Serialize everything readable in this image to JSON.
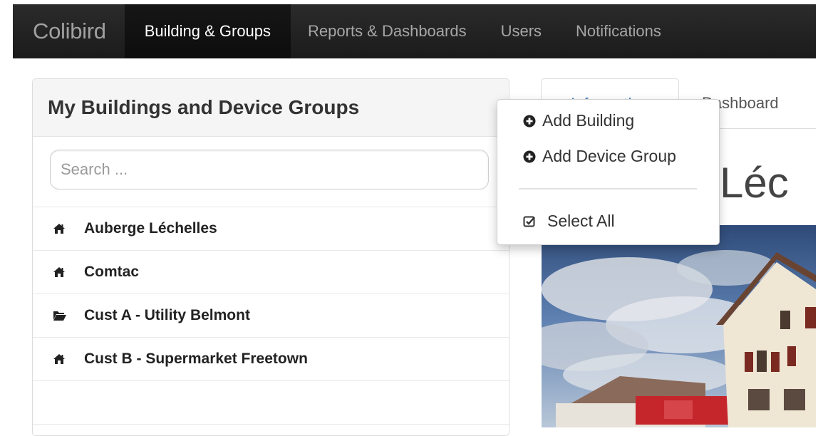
{
  "navbar": {
    "brand": "Colibird",
    "items": [
      {
        "label": "Building & Groups",
        "active": true
      },
      {
        "label": "Reports & Dashboards",
        "active": false
      },
      {
        "label": "Users",
        "active": false
      },
      {
        "label": "Notifications",
        "active": false
      }
    ]
  },
  "panel": {
    "title": "My Buildings and Device Groups",
    "search_placeholder": "Search ...",
    "items": [
      {
        "label": "Auberge Léchelles",
        "icon": "home-icon"
      },
      {
        "label": "Comtac",
        "icon": "home-icon"
      },
      {
        "label": "Cust A - Utility Belmont",
        "icon": "folder-open-icon"
      },
      {
        "label": "Cust B - Supermarket Freetown",
        "icon": "home-icon"
      }
    ]
  },
  "tabs": {
    "active_label": "Information",
    "dashboard_label": "Dashboard"
  },
  "content": {
    "title_fragment": "e Léc"
  },
  "dropdown": {
    "add_building": "Add Building",
    "add_device_group": "Add Device Group",
    "select_all": "Select All"
  },
  "colors": {
    "navbar_bg": "#222222",
    "link_blue": "#337ab7",
    "panel_heading_bg": "#f5f5f5"
  }
}
